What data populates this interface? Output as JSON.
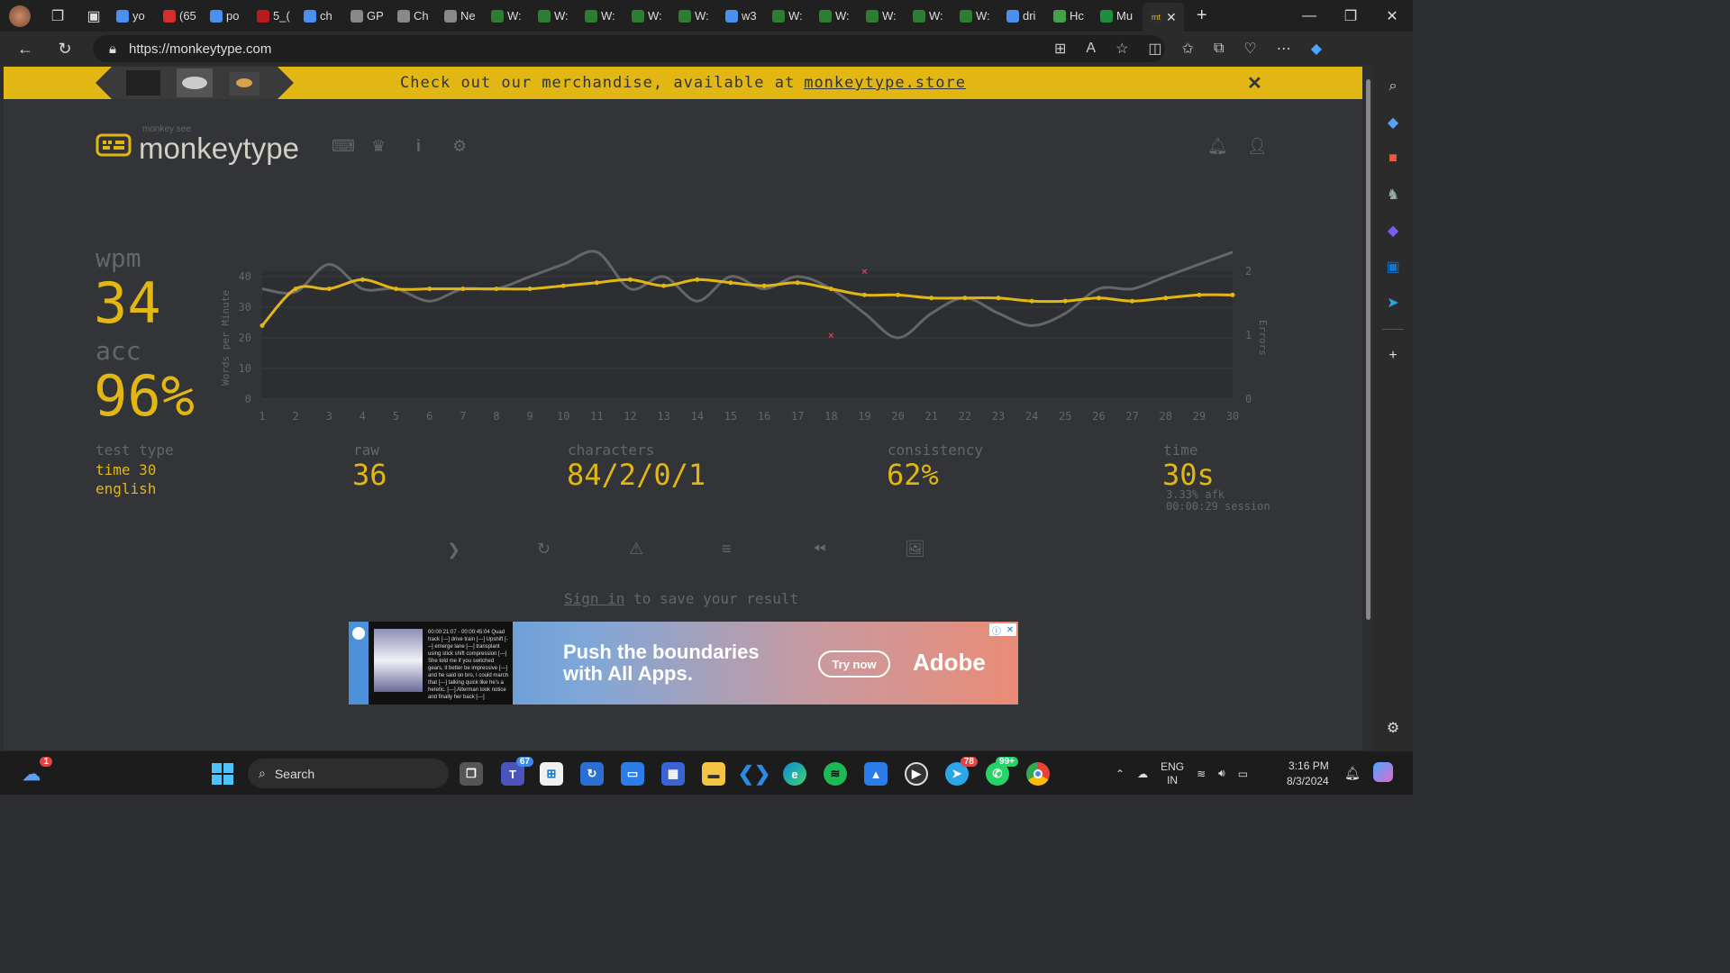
{
  "browser": {
    "tabs": [
      {
        "label": "yo",
        "color": "#4b8ff0"
      },
      {
        "label": "(65",
        "color": "#d32f2f"
      },
      {
        "label": "po",
        "color": "#4b8ff0"
      },
      {
        "label": "5_(",
        "color": "#b71c1c"
      },
      {
        "label": "ch",
        "color": "#4b8ff0"
      },
      {
        "label": "GP",
        "color": "#888888"
      },
      {
        "label": "Ch",
        "color": "#888888"
      },
      {
        "label": "Ne",
        "color": "#888888"
      },
      {
        "label": "W:",
        "color": "#2e7d32"
      },
      {
        "label": "W:",
        "color": "#2e7d32"
      },
      {
        "label": "W:",
        "color": "#2e7d32"
      },
      {
        "label": "W:",
        "color": "#2e7d32"
      },
      {
        "label": "W:",
        "color": "#2e7d32"
      },
      {
        "label": "w3",
        "color": "#4b8ff0"
      },
      {
        "label": "W:",
        "color": "#2e7d32"
      },
      {
        "label": "W:",
        "color": "#2e7d32"
      },
      {
        "label": "W:",
        "color": "#2e7d32"
      },
      {
        "label": "W:",
        "color": "#2e7d32"
      },
      {
        "label": "W:",
        "color": "#2e7d32"
      },
      {
        "label": "dri",
        "color": "#4b8ff0"
      },
      {
        "label": "Hc",
        "color": "#43a047"
      },
      {
        "label": "Mu",
        "color": "#1e8e3e"
      }
    ],
    "active_tab": {
      "label": "mt",
      "color": "#e2b714"
    },
    "url": "https://monkeytype.com"
  },
  "banner": {
    "text": "Check out our merchandise, available at",
    "link": "monkeytype.store",
    "close": "✕"
  },
  "header": {
    "logo_sub": "monkey see",
    "logo_title": "monkeytype"
  },
  "result": {
    "wpm_label": "wpm",
    "wpm": "34",
    "acc_label": "acc",
    "acc": "96%",
    "test_type_label": "test type",
    "test_type_line1": "time 30",
    "test_type_line2": "english",
    "raw_label": "raw",
    "raw": "36",
    "characters_label": "characters",
    "characters": "84/2/0/1",
    "consistency_label": "consistency",
    "consistency": "62%",
    "time_label": "time",
    "time": "30s",
    "afk": "3.33% afk",
    "session": "00:00:29 session",
    "signin_link": "Sign in",
    "signin_text": " to save your result"
  },
  "ad": {
    "headline1": "Push the boundaries",
    "headline2": "with All Apps.",
    "cta": "Try now",
    "brand": "Adobe",
    "thumb_text": "00:00:21:07 - 00:00:45:04 Quad track [---] drive train [---] Upshift [---] emerge lane [---] transplant using stick shift compression [---] She told me if you switched gears, it better be impressive [---] and he said on bro, I could march that [---] talking quick like he's a heretic. [---] Alterman took notice and finally her back [---]"
  },
  "chart_data": {
    "type": "line",
    "x": [
      1,
      2,
      3,
      4,
      5,
      6,
      7,
      8,
      9,
      10,
      11,
      12,
      13,
      14,
      15,
      16,
      17,
      18,
      19,
      20,
      21,
      22,
      23,
      24,
      25,
      26,
      27,
      28,
      29,
      30
    ],
    "xlabel": "",
    "ylabel": "Words per Minute",
    "y2label": "Errors",
    "ylim": [
      0,
      40
    ],
    "yticks": [
      0,
      10,
      20,
      30,
      40
    ],
    "y2lim": [
      0,
      2
    ],
    "y2ticks": [
      0,
      1,
      2
    ],
    "series": [
      {
        "color": "#646669",
        "values": [
          36,
          35,
          44,
          36,
          36,
          32,
          36,
          36,
          40,
          44,
          48,
          36,
          40,
          32,
          40,
          36,
          40,
          36,
          28,
          20,
          28,
          33,
          28,
          24,
          28,
          36,
          36,
          40,
          44,
          48
        ]
      },
      {
        "color": "#e2b714",
        "values": [
          24,
          36,
          36,
          39,
          36,
          36,
          36,
          36,
          36,
          37,
          38,
          39,
          37,
          39,
          38,
          37,
          38,
          36,
          34,
          34,
          33,
          33,
          33,
          32,
          32,
          33,
          32,
          33,
          34,
          34
        ]
      }
    ],
    "errors": [
      {
        "x": 18,
        "y2": 1
      },
      {
        "x": 19,
        "y2": 2
      }
    ]
  },
  "taskbar": {
    "search_placeholder": "Search",
    "teams_badge": "67",
    "telegram_badge": "78",
    "whatsapp_badge": "99+",
    "widget_badge": "1",
    "lang1": "ENG",
    "lang2": "IN",
    "time": "3:16 PM",
    "date": "8/3/2024"
  }
}
